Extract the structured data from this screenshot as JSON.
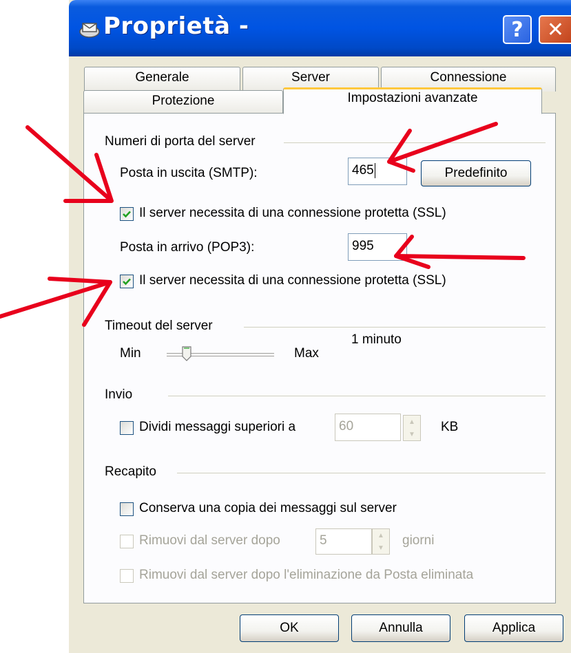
{
  "window": {
    "title": "Proprietà -",
    "help_glyph": "?",
    "close_glyph": "✕"
  },
  "tabs": {
    "row1": [
      "Generale",
      "Server",
      "Connessione"
    ],
    "row2": [
      "Protezione",
      "Impostazioni avanzate"
    ],
    "active": "Impostazioni avanzate"
  },
  "ports": {
    "group_label": "Numeri di porta del server",
    "smtp_label": "Posta in uscita (SMTP):",
    "smtp_value": "465",
    "default_button": "Predefinito",
    "ssl_smtp_label": "Il server necessita di una connessione protetta (SSL)",
    "ssl_smtp_checked": true,
    "pop3_label": "Posta in arrivo (POP3):",
    "pop3_value": "995",
    "ssl_pop3_label": "Il server necessita di una connessione protetta (SSL)",
    "ssl_pop3_checked": true
  },
  "timeout": {
    "group_label": "Timeout del server",
    "min_label": "Min",
    "max_label": "Max",
    "value_text": "1 minuto",
    "slider_level": 0.15
  },
  "send": {
    "group_label": "Invio",
    "split_label": "Dividi messaggi superiori a",
    "split_checked": false,
    "split_value": "60",
    "unit": "KB"
  },
  "delivery": {
    "group_label": "Recapito",
    "keep_copy_label": "Conserva una copia dei messaggi sul server",
    "keep_copy_checked": false,
    "remove_after_label": "Rimuovi dal server dopo",
    "remove_after_value": "5",
    "days_label": "giorni",
    "remove_deleted_label": "Rimuovi dal server dopo l'eliminazione da Posta eliminata"
  },
  "buttons": {
    "ok": "OK",
    "cancel": "Annulla",
    "apply": "Applica"
  },
  "colors": {
    "annotation_arrows": "#e8001c",
    "titlebar": "#0054e3",
    "tab_highlight": "#ffc83c",
    "checkmark": "#21a121"
  }
}
